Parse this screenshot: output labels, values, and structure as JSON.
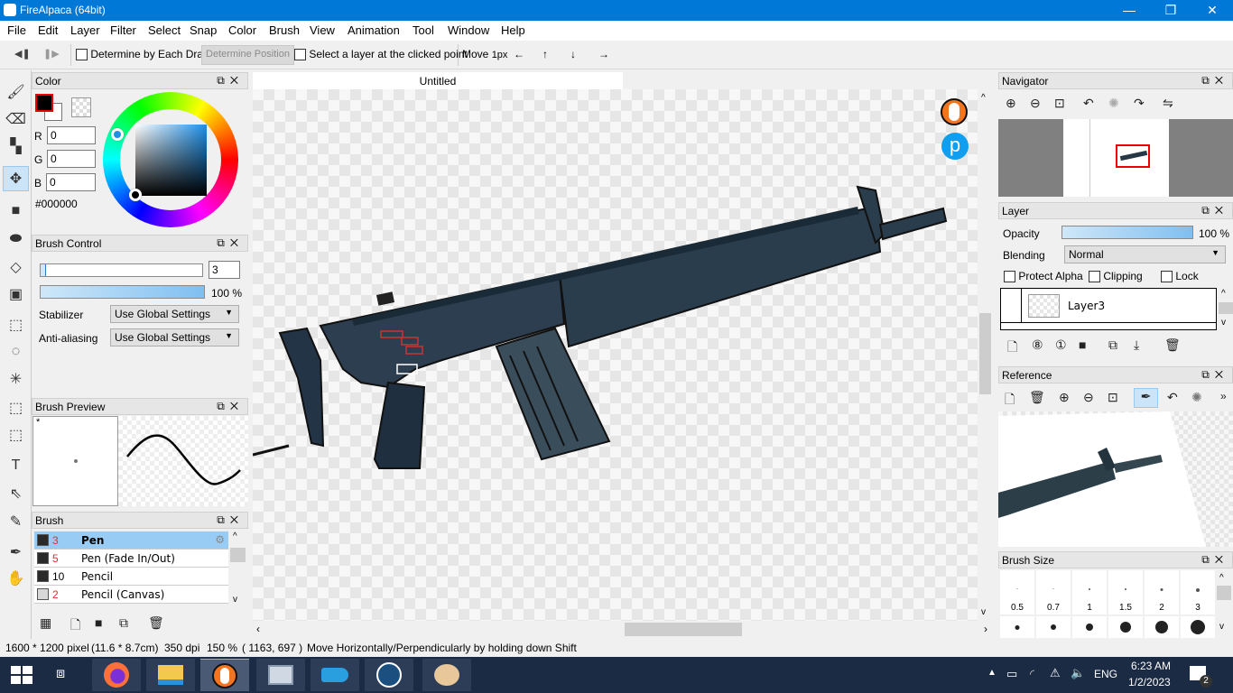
{
  "window": {
    "title": "FireAlpaca (64bit)",
    "minimize": "—",
    "restore": "❐",
    "close": "✕"
  },
  "menu": [
    "File",
    "Edit",
    "Layer",
    "Filter",
    "Select",
    "Snap",
    "Color",
    "Brush",
    "View",
    "Animation",
    "Tool",
    "Window",
    "Help"
  ],
  "toolbar": {
    "prev": "◀❚",
    "next": "❚▶",
    "determine_by_drag": "Determine by Each Drag",
    "determine_position": "Determine Position",
    "select_layer_clicked": "Select a layer at the clicked point",
    "move_label": "Move",
    "move_step": "1px",
    "arrows": [
      "←",
      "↑",
      "↓",
      "→"
    ]
  },
  "tools": [
    {
      "name": "brush-tool-icon",
      "glyph": "🖌",
      "active": false
    },
    {
      "name": "eraser-tool-icon",
      "glyph": "⌫",
      "active": false
    },
    {
      "name": "dot-tool-icon",
      "glyph": "▚",
      "active": false
    },
    {
      "name": "move-tool-icon",
      "glyph": "✥",
      "active": true
    },
    {
      "name": "fill-rect-tool-icon",
      "glyph": "■",
      "active": false
    },
    {
      "name": "fill-lasso-tool-icon",
      "glyph": "⬬",
      "active": false
    },
    {
      "name": "bucket-tool-icon",
      "glyph": "◇",
      "active": false
    },
    {
      "name": "gradient-tool-icon",
      "glyph": "▣",
      "active": false
    },
    {
      "name": "select-rect-tool-icon",
      "glyph": "⬚",
      "active": false
    },
    {
      "name": "lasso-tool-icon",
      "glyph": "◌",
      "active": false
    },
    {
      "name": "magic-wand-tool-icon",
      "glyph": "✳",
      "active": false
    },
    {
      "name": "select-pen-tool-icon",
      "glyph": "⬚",
      "active": false
    },
    {
      "name": "select-eraser-tool-icon",
      "glyph": "⬚",
      "active": false
    },
    {
      "name": "text-tool-icon",
      "glyph": "T",
      "active": false
    },
    {
      "name": "object-tool-icon",
      "glyph": "⇖",
      "active": false
    },
    {
      "name": "divide-tool-icon",
      "glyph": "✎",
      "active": false
    },
    {
      "name": "eyedropper-tool-icon",
      "glyph": "✒",
      "active": false
    },
    {
      "name": "hand-tool-icon",
      "glyph": "✋",
      "active": false
    }
  ],
  "color_panel": {
    "title": "Color",
    "r_label": "R",
    "r": "0",
    "g_label": "G",
    "g": "0",
    "b_label": "B",
    "b": "0",
    "hex": "#000000",
    "fg": "#000000",
    "bg": "#ffffff"
  },
  "brush_control": {
    "title": "Brush Control",
    "size": "3",
    "size_fraction": 0.03,
    "opacity": "100 %",
    "opacity_fraction": 1.0,
    "stabilizer_label": "Stabilizer",
    "stabilizer_value": "Use Global Settings",
    "antialias_label": "Anti-aliasing",
    "antialias_value": "Use Global Settings"
  },
  "brush_preview": {
    "title": "Brush Preview",
    "marker": "*"
  },
  "brush_panel": {
    "title": "Brush",
    "items": [
      {
        "num": "3",
        "name": "Pen",
        "selected": true,
        "dark": true,
        "red": true
      },
      {
        "num": "5",
        "name": "Pen (Fade In/Out)",
        "selected": false,
        "dark": true,
        "red": true
      },
      {
        "num": "10",
        "name": "Pencil",
        "selected": false,
        "dark": true,
        "red": false
      },
      {
        "num": "2",
        "name": "Pencil (Canvas)",
        "selected": false,
        "dark": false,
        "red": true
      }
    ]
  },
  "document": {
    "tab": "Untitled"
  },
  "navigator": {
    "title": "Navigator"
  },
  "layer_panel": {
    "title": "Layer",
    "opacity_label": "Opacity",
    "opacity": "100 %",
    "opacity_fraction": 1.0,
    "blending_label": "Blending",
    "blending_value": "Normal",
    "protect_alpha": "Protect Alpha",
    "clipping": "Clipping",
    "lock": "Lock",
    "layers": [
      "Layer3"
    ]
  },
  "reference_panel": {
    "title": "Reference",
    "more": "»"
  },
  "brush_size_panel": {
    "title": "Brush Size",
    "sizes": [
      "0.5",
      "0.7",
      "1",
      "1.5",
      "2",
      "3"
    ]
  },
  "status": {
    "canvas_size": "1600 * 1200 pixel",
    "physical_size": "(11.6 * 8.7cm)",
    "dpi": "350 dpi",
    "zoom": "150 %",
    "coords": "( 1163, 697 )",
    "hint": "Move Horizontally/Perpendicularly by holding down Shift"
  },
  "taskbar": {
    "apps": [
      "firefox",
      "file-explorer",
      "firealpaca",
      "resource-monitor",
      "app-blue",
      "steam",
      "paint"
    ],
    "lang": "ENG",
    "time": "6:23 AM",
    "date": "1/2/2023",
    "notifications": "2"
  }
}
